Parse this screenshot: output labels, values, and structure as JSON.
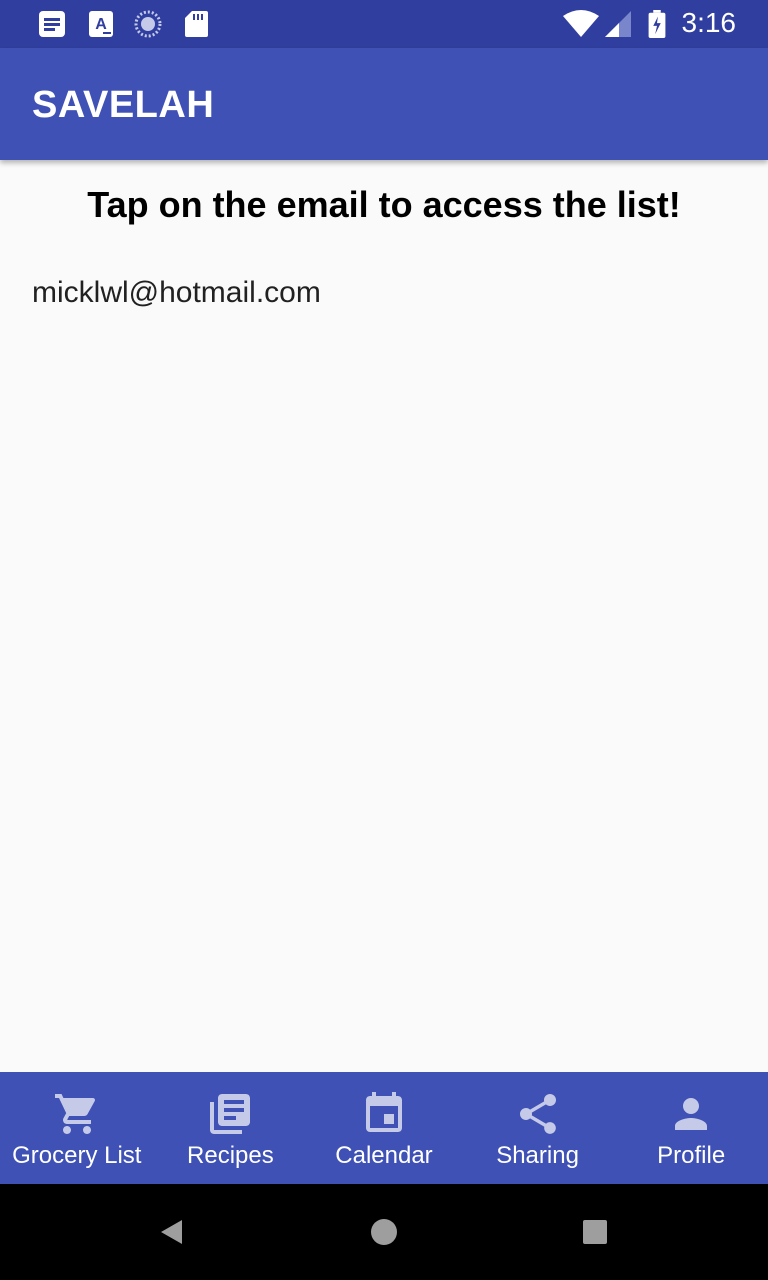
{
  "status_bar": {
    "time": "3:16",
    "icons_left": [
      "document-icon",
      "keyboard-a-icon",
      "sync-circle-icon",
      "sd-card-icon"
    ],
    "icons_right": [
      "wifi-icon",
      "signal-icon",
      "battery-charging-icon"
    ]
  },
  "app_bar": {
    "title": "SAVELAH"
  },
  "main": {
    "heading": "Tap on the email to access the list!",
    "emails": [
      "micklwl@hotmail.com"
    ]
  },
  "bottom_nav": {
    "items": [
      {
        "label": "Grocery List",
        "icon": "cart-icon"
      },
      {
        "label": "Recipes",
        "icon": "recipes-icon"
      },
      {
        "label": "Calendar",
        "icon": "calendar-icon"
      },
      {
        "label": "Sharing",
        "icon": "share-icon"
      },
      {
        "label": "Profile",
        "icon": "person-icon"
      }
    ]
  },
  "colors": {
    "primary": "#3f51b5",
    "primary_dark": "#303f9f",
    "nav_icon": "#c5cae9",
    "background": "#fafafa"
  }
}
